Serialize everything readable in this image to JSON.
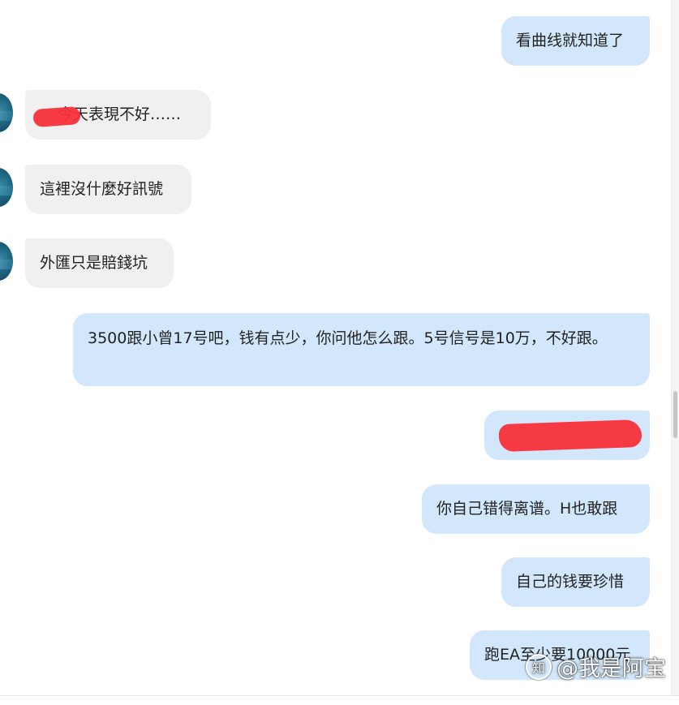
{
  "messages": [
    {
      "side": "out",
      "text": "看曲线就知道了"
    },
    {
      "side": "in",
      "text": "今天表現不好……",
      "redacted": true
    },
    {
      "side": "in",
      "text": "這裡沒什麼好訊號"
    },
    {
      "side": "in",
      "text": "外匯只是賠錢坑"
    },
    {
      "side": "out",
      "text": "3500跟小曾17号吧，钱有点少，你问他怎么跟。5号信号是10万，不好跟。"
    },
    {
      "side": "out",
      "text": "",
      "redacted": true
    },
    {
      "side": "out",
      "text": "你自己错得离谱。H也敢跟"
    },
    {
      "side": "out",
      "text": "自己的钱要珍惜"
    },
    {
      "side": "out",
      "text": "跑EA至少要10000元"
    }
  ],
  "watermark": {
    "logo": "知",
    "text": "@我是阿宝"
  },
  "colors": {
    "outgoing_bubble": "#d2e7fb",
    "incoming_bubble": "#f0f0f0",
    "redaction": "#f7303a"
  }
}
